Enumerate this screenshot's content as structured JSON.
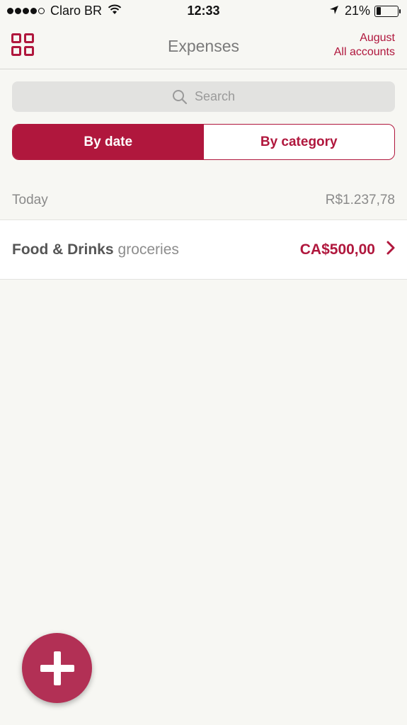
{
  "status_bar": {
    "carrier": "Claro BR",
    "time": "12:33",
    "battery_percent": "21%",
    "battery_level": 0.21,
    "signal_bars_filled": 4,
    "signal_bars_total": 5
  },
  "nav": {
    "title": "Expenses",
    "period": "August",
    "account_filter": "All accounts",
    "left_icon": "grid-icon"
  },
  "search": {
    "placeholder": "Search",
    "icon": "search-icon"
  },
  "view_toggle": {
    "options": [
      "By date",
      "By category"
    ],
    "selected": "By date"
  },
  "sections": [
    {
      "label": "Today",
      "total": "R$1.237,78",
      "items": [
        {
          "category": "Food & Drinks",
          "note": "groceries",
          "amount": "CA$500,00"
        }
      ]
    }
  ],
  "colors": {
    "accent": "#b0173d",
    "fab": "#b23055",
    "background": "#f7f7f3"
  },
  "fab": {
    "icon": "plus-icon"
  }
}
